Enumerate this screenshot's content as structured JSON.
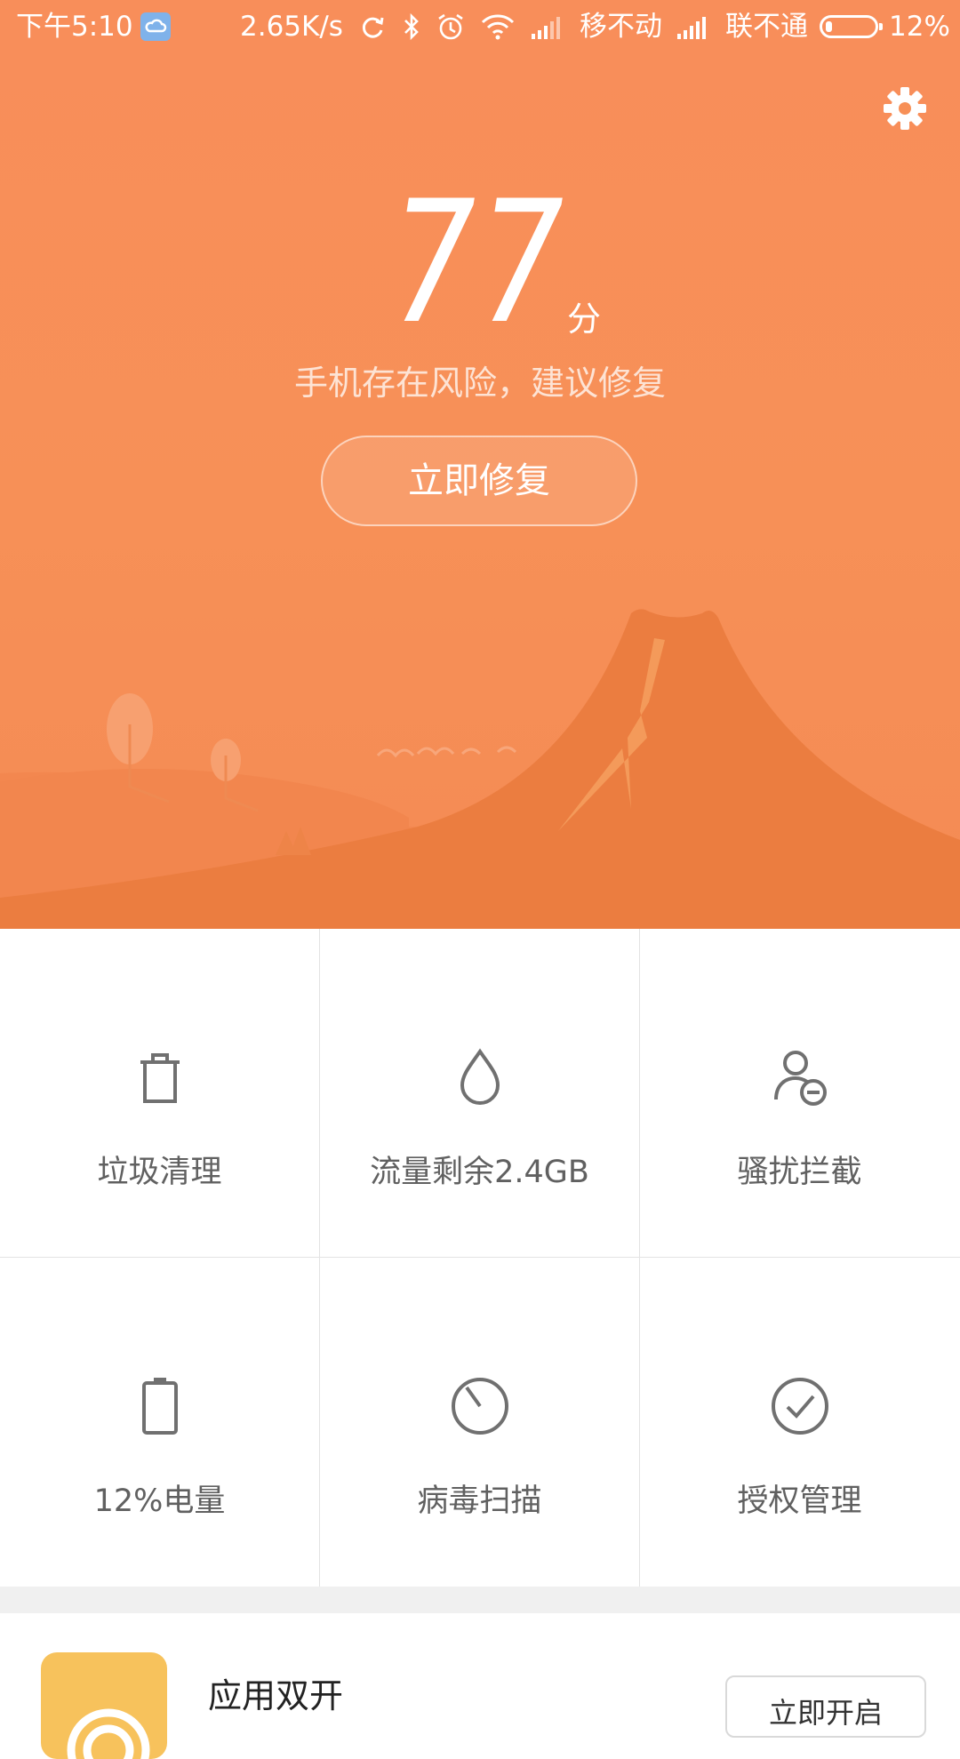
{
  "status_bar": {
    "time": "下午5:10",
    "net_speed": "2.65K/s",
    "carrier1": "移不动",
    "carrier2": "联不通",
    "battery": "12%"
  },
  "header": {
    "score": "77",
    "score_unit": "分",
    "risk_text": "手机存在风险，建议修复",
    "fix_button": "立即修复",
    "bg_color": "#F79057"
  },
  "grid": {
    "items": [
      {
        "label": "垃圾清理",
        "icon": "trash-icon"
      },
      {
        "label": "流量剩余2.4GB",
        "icon": "drop-icon"
      },
      {
        "label": "骚扰拦截",
        "icon": "user-block-icon"
      },
      {
        "label": "12%电量",
        "icon": "battery-icon"
      },
      {
        "label": "病毒扫描",
        "icon": "scan-icon"
      },
      {
        "label": "授权管理",
        "icon": "check-circle-icon"
      }
    ]
  },
  "promo": {
    "title": "应用双开",
    "button": "立即开启"
  }
}
